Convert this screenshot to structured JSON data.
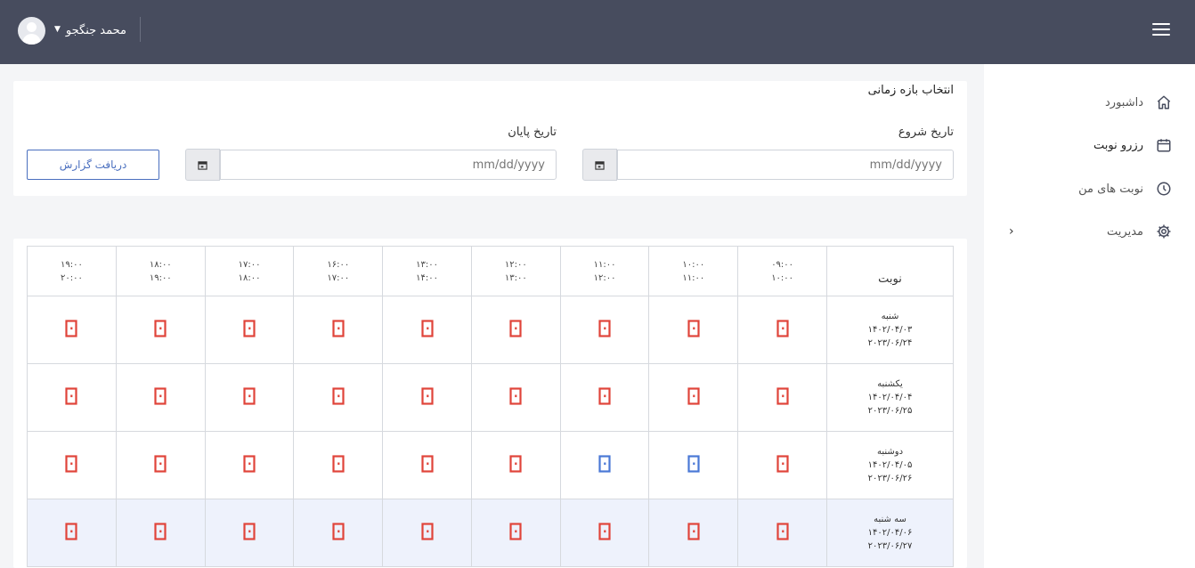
{
  "user": {
    "name": "محمد جنگجو"
  },
  "sidebar": {
    "items": [
      {
        "label": "داشبورد",
        "icon": "home-icon"
      },
      {
        "label": "رزرو نوبت",
        "icon": "calendar-icon"
      },
      {
        "label": "نوبت های من",
        "icon": "clock-icon"
      },
      {
        "label": "مدیریت",
        "icon": "gear-icon"
      }
    ]
  },
  "filter": {
    "title": "انتخاب بازه زمانی",
    "start_label": "تاریخ شروع",
    "end_label": "تاریخ پایان",
    "start_placeholder": "mm/dd/yyyy",
    "end_placeholder": "mm/dd/yyyy",
    "report_button": "دریافت گزارش"
  },
  "table": {
    "corner_header": "نوبت",
    "slots": [
      {
        "from": "۰۹:۰۰",
        "to": "۱۰:۰۰"
      },
      {
        "from": "۱۰:۰۰",
        "to": "۱۱:۰۰"
      },
      {
        "from": "۱۱:۰۰",
        "to": "۱۲:۰۰"
      },
      {
        "from": "۱۲:۰۰",
        "to": "۱۳:۰۰"
      },
      {
        "from": "۱۳:۰۰",
        "to": "۱۴:۰۰"
      },
      {
        "from": "۱۶:۰۰",
        "to": "۱۷:۰۰"
      },
      {
        "from": "۱۷:۰۰",
        "to": "۱۸:۰۰"
      },
      {
        "from": "۱۸:۰۰",
        "to": "۱۹:۰۰"
      },
      {
        "from": "۱۹:۰۰",
        "to": "۲۰:۰۰"
      }
    ],
    "rows": [
      {
        "day": "شنبه",
        "jalali": "۱۴۰۲/۰۴/۰۳",
        "gregorian": "۲۰۲۳/۰۶/۲۴",
        "highlight": false,
        "status": [
          "booked",
          "booked",
          "booked",
          "booked",
          "booked",
          "booked",
          "booked",
          "booked",
          "booked"
        ]
      },
      {
        "day": "یکشنبه",
        "jalali": "۱۴۰۲/۰۴/۰۴",
        "gregorian": "۲۰۲۳/۰۶/۲۵",
        "highlight": false,
        "status": [
          "booked",
          "booked",
          "booked",
          "booked",
          "booked",
          "booked",
          "booked",
          "booked",
          "booked"
        ]
      },
      {
        "day": "دوشنبه",
        "jalali": "۱۴۰۲/۰۴/۰۵",
        "gregorian": "۲۰۲۳/۰۶/۲۶",
        "highlight": false,
        "status": [
          "booked",
          "available",
          "available",
          "booked",
          "booked",
          "booked",
          "booked",
          "booked",
          "booked"
        ]
      },
      {
        "day": "سه شنبه",
        "jalali": "۱۴۰۲/۰۴/۰۶",
        "gregorian": "۲۰۲۳/۰۶/۲۷",
        "highlight": true,
        "status": [
          "booked",
          "booked",
          "booked",
          "booked",
          "booked",
          "booked",
          "booked",
          "booked",
          "booked"
        ]
      }
    ]
  },
  "colors": {
    "topbar": "#474c5e",
    "booked": "#e0443a",
    "available": "#4a78d6",
    "accent": "#4a6fbf"
  }
}
